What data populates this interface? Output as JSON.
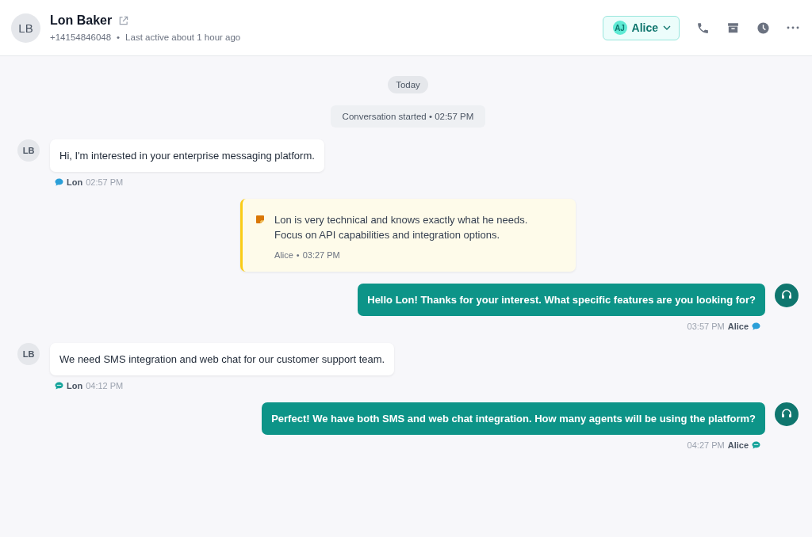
{
  "contact": {
    "initials": "LB",
    "name": "Lon Baker",
    "phone": "+14154846048",
    "separator": "•",
    "last_active": "Last active about 1 hour ago"
  },
  "assignee": {
    "initials": "AJ",
    "name": "Alice"
  },
  "date_divider": "Today",
  "messages": [
    {
      "kind": "system",
      "text": "Conversation started • 02:57 PM"
    },
    {
      "kind": "incoming",
      "initials": "LB",
      "text": "Hi, I'm interested in your enterprise messaging platform.",
      "sender": "Lon",
      "time": "02:57 PM",
      "channel": {
        "kind": "chat"
      }
    },
    {
      "kind": "note",
      "text": "Lon is very technical and knows exactly what he needs. Focus on API capabilities and integration options.",
      "sender": "Alice",
      "separator": "•",
      "time": "03:27 PM"
    },
    {
      "kind": "outgoing",
      "text": "Hello Lon! Thanks for your interest. What specific features are you looking for?",
      "sender": "Alice",
      "time": "03:57 PM",
      "channel": {
        "kind": "chat"
      }
    },
    {
      "kind": "incoming",
      "initials": "LB",
      "text": "We need SMS integration and web chat for our customer support team.",
      "sender": "Lon",
      "time": "04:12 PM",
      "channel": {
        "kind": "sms"
      }
    },
    {
      "kind": "outgoing",
      "text": "Perfect! We have both SMS and web chat integration. How many agents will be using the platform?",
      "sender": "Alice",
      "time": "04:27 PM",
      "channel": {
        "kind": "sms"
      }
    }
  ]
}
